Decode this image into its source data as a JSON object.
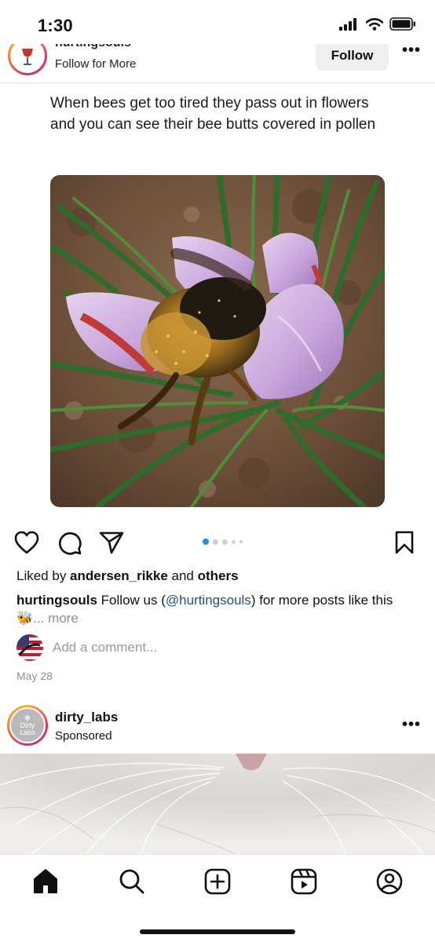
{
  "status_bar": {
    "time": "1:30"
  },
  "post": {
    "username": "hurtingsouls",
    "subtitle": "Follow for More",
    "follow_label": "Follow",
    "more_glyph": "•••",
    "caption_text": "When bees get too tired they pass out in flowers and you can see their bee butts covered in pollen",
    "carousel": {
      "total": 5,
      "active": 1
    },
    "liked_prefix": "Liked by ",
    "liked_user": "andersen_rikke",
    "liked_mid": " and ",
    "liked_others": "others",
    "caption_user": "hurtingsouls",
    "caption_body_1": " Follow us (",
    "caption_mention": "@hurtingsouls",
    "caption_body_2": ") for more posts like this",
    "caption_emoji": "🐝",
    "caption_more": "... more",
    "comment_placeholder": "Add a comment...",
    "date": "May 28"
  },
  "sponsored": {
    "username": "dirty_labs",
    "label": "Sponsored",
    "avatar_text": "Dirty Labs",
    "more_glyph": "•••"
  },
  "icons": {
    "like": "heart-icon",
    "comment": "comment-icon",
    "share": "send-icon",
    "save": "bookmark-icon",
    "nav": [
      "home-icon",
      "search-icon",
      "create-icon",
      "reels-icon",
      "profile-icon"
    ]
  },
  "colors": {
    "accent": "#1e90e8",
    "mention": "#1b4f8a",
    "muted": "#8e8e8e"
  }
}
